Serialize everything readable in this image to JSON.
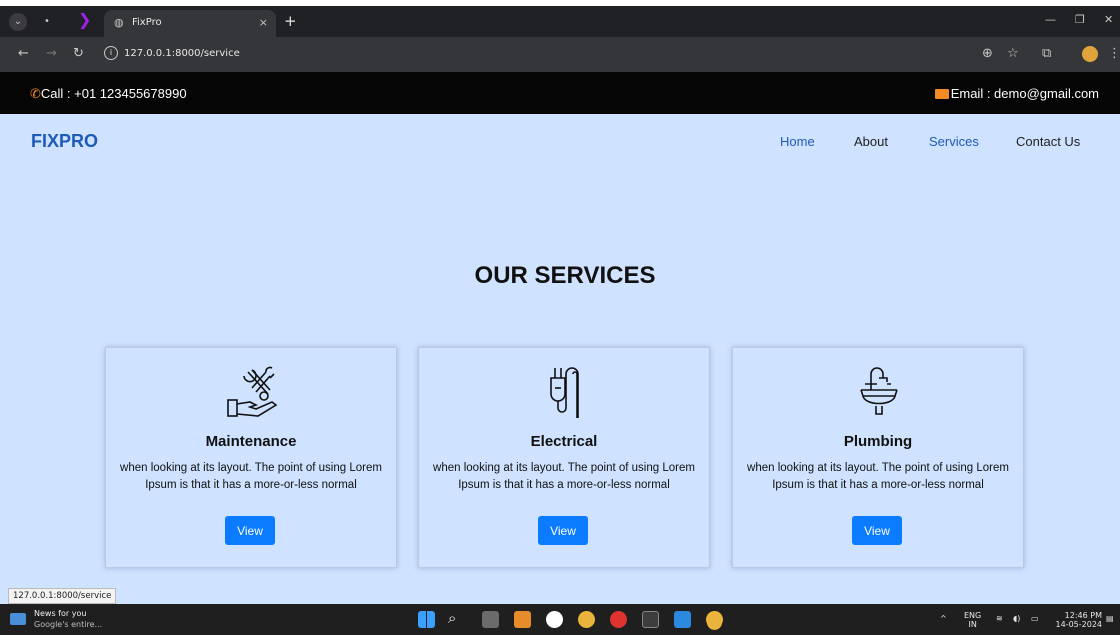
{
  "browser": {
    "tab_title": "FixPro",
    "tab_close": "×",
    "new_tab": "+",
    "url": "127.0.0.1:8000/service",
    "status_url": "127.0.0.1:8000/service"
  },
  "infobar": {
    "call_label": "Call : +01 123455678990",
    "email_label": "Email : demo@gmail.com"
  },
  "nav": {
    "brand": "FIXPRO",
    "items": [
      {
        "label": "Home",
        "active": true
      },
      {
        "label": "About",
        "active": false
      },
      {
        "label": "Services",
        "active": true
      },
      {
        "label": "Contact Us",
        "active": false
      }
    ]
  },
  "page": {
    "heading": "OUR SERVICES"
  },
  "services": [
    {
      "icon": "tools-hand-icon",
      "title": "Maintenance",
      "description": "when looking at its layout. The point of using Lorem Ipsum is that it has a more-or-less normal",
      "button": "View"
    },
    {
      "icon": "plug-icon",
      "title": "Electrical",
      "description": "when looking at its layout. The point of using Lorem Ipsum is that it has a more-or-less normal",
      "button": "View"
    },
    {
      "icon": "sink-icon",
      "title": "Plumbing",
      "description": "when looking at its layout. The point of using Lorem Ipsum is that it has a more-or-less normal",
      "button": "View"
    }
  ],
  "taskbar": {
    "news_title": "News for you",
    "news_sub": "Google's entire...",
    "lang_top": "ENG",
    "lang_bottom": "IN",
    "time": "12:46 PM",
    "date": "14-05-2024"
  },
  "colors": {
    "page_bg": "#cfe2ff",
    "brand": "#1e5bb8",
    "button": "#0b7bff",
    "accent_orange": "#f48a22"
  }
}
